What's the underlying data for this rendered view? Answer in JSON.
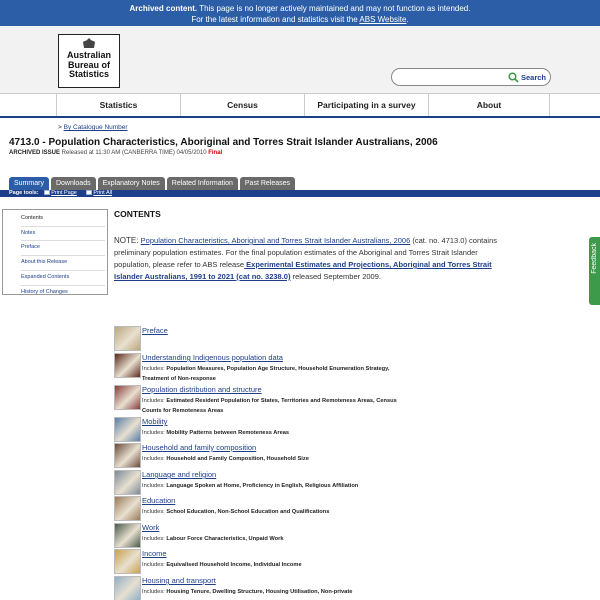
{
  "banner": {
    "bold": "Archived content.",
    "line1": " This page is no longer actively maintained and may not function as intended.",
    "line2_prefix": "For the latest information and statistics visit the ",
    "line2_link": "ABS Website",
    "line2_suffix": "."
  },
  "logo": {
    "line1": "Australian",
    "line2": "Bureau of",
    "line3": "Statistics"
  },
  "search": {
    "value": "",
    "placeholder": "",
    "button": "Search"
  },
  "nav": {
    "items": [
      "Statistics",
      "Census",
      "Participating in a survey",
      "About"
    ]
  },
  "breadcrumb": {
    "prefix": "> ",
    "link": "By Catalogue Number"
  },
  "page": {
    "title": "4713.0 - Population Characteristics, Aboriginal and Torres Strait Islander Australians, 2006",
    "issue_label": "ARCHIVED ISSUE",
    "issue_text": " Released at 11:30 AM (CANBERRA TIME) 04/05/2010 ",
    "issue_status": "Final"
  },
  "tabs": [
    "Summary",
    "Downloads",
    "Explanatory Notes",
    "Related Information",
    "Past Releases"
  ],
  "toolbar": {
    "label": "Page tools:",
    "print_page": "Print Page",
    "print_all": "Print All"
  },
  "leftnav": {
    "items": [
      "Contents",
      "Notes",
      "Preface",
      "About this Release",
      "Expanded Contents",
      "History of Changes"
    ]
  },
  "contents": {
    "heading": "CONTENTS",
    "note_label": "NOTE: ",
    "note_link1": "Population Characteristics, Aboriginal and Torres Strait Islander Australians, 2006",
    "note_text1": " (cat. no. 4713.0) contains preliminary population estimates. For the final population estimates of the Aboriginal and Torres Strait Islander population, please refer to ABS release",
    "note_link2": " Experimental Estimates and Projections, Aboriginal and Torres Strait Islander Australians, 1991 to 2021 (cat no. 3238.0)",
    "note_text2": " released September 2009."
  },
  "chapters": [
    {
      "title": "Preface",
      "includes_label": "",
      "includes": "",
      "thumb_color": "#b9a77c"
    },
    {
      "title": "Understanding Indigenous population data",
      "includes_label": "Includes: ",
      "includes": "Population Measures, Population Age Structure, Household Enumeration Strategy, Treatment of Non-response",
      "thumb_color": "#5a2a1c"
    },
    {
      "title": "Population distribution and structure",
      "includes_label": "Includes: ",
      "includes": "Estimated Resident Population for States, Territories and Remoteness Areas, Census Counts for Remoteness Areas",
      "thumb_color": "#8a3b3b"
    },
    {
      "title": "Mobility",
      "includes_label": "Includes: ",
      "includes": "Mobility Patterns between Remoteness Areas",
      "thumb_color": "#5b7fa8"
    },
    {
      "title": "Household and family composition",
      "includes_label": "Includes: ",
      "includes": "Household and Family Composition, Household Size",
      "thumb_color": "#6b4a3a"
    },
    {
      "title": "Language and religion",
      "includes_label": "Includes: ",
      "includes": "Language Spoken at Home, Proficiency in English, Religious Affiliation",
      "thumb_color": "#7b8a9a"
    },
    {
      "title": "Education",
      "includes_label": "Includes: ",
      "includes": "School Education, Non-School Education and Qualifications",
      "thumb_color": "#9a7a5a"
    },
    {
      "title": "Work",
      "includes_label": "Includes: ",
      "includes": "Labour Force Characteristics, Unpaid Work",
      "thumb_color": "#4a5a4a"
    },
    {
      "title": "Income",
      "includes_label": "Includes: ",
      "includes": "Equivalised Household Income, Individual Income",
      "thumb_color": "#c9a24a"
    },
    {
      "title": "Housing and transport",
      "includes_label": "Includes: ",
      "includes": "Housing Tenure, Dwelling Structure, Housing Utilisation, Non-private",
      "thumb_color": "#8fb0c8"
    }
  ],
  "feedback": {
    "label": "Feedback"
  },
  "colors": {
    "banner": "#2c5ea8",
    "link": "#1d3f8a",
    "status_final": "#cc0000",
    "feedback": "#3e9a4b"
  }
}
